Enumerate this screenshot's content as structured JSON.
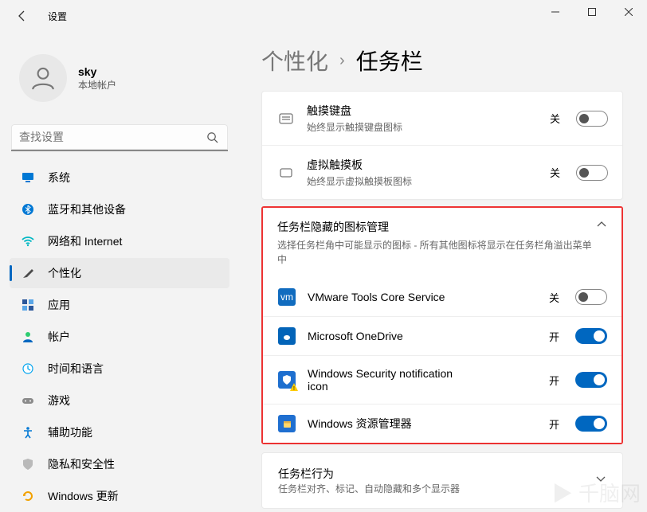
{
  "title_bar": {
    "app_title": "设置"
  },
  "user": {
    "name": "sky",
    "subtitle": "本地帐户"
  },
  "search": {
    "placeholder": "查找设置"
  },
  "nav": [
    {
      "label": "系统",
      "icon": "monitor",
      "color": "#0078d4"
    },
    {
      "label": "蓝牙和其他设备",
      "icon": "bluetooth",
      "color": "#0078d4"
    },
    {
      "label": "网络和 Internet",
      "icon": "wifi",
      "color": "#00b7c3"
    },
    {
      "label": "个性化",
      "icon": "brush",
      "color": "#4b4b4b",
      "selected": true
    },
    {
      "label": "应用",
      "icon": "apps",
      "color": "#2b579a"
    },
    {
      "label": "帐户",
      "icon": "account",
      "color": "#0067c0"
    },
    {
      "label": "时间和语言",
      "icon": "clock",
      "color": "#00a4ef"
    },
    {
      "label": "游戏",
      "icon": "game",
      "color": "#8a8a8a"
    },
    {
      "label": "辅助功能",
      "icon": "accessibility",
      "color": "#0078d4"
    },
    {
      "label": "隐私和安全性",
      "icon": "shield",
      "color": "#888888"
    },
    {
      "label": "Windows 更新",
      "icon": "update",
      "color": "#f2a100"
    }
  ],
  "breadcrumb": {
    "parent": "个性化",
    "current": "任务栏"
  },
  "panel1": {
    "rows": [
      {
        "title": "触摸键盘",
        "sub": "始终显示触摸键盘图标",
        "state_label": "关",
        "on": false
      },
      {
        "title": "虚拟触摸板",
        "sub": "始终显示虚拟触摸板图标",
        "state_label": "关",
        "on": false
      }
    ]
  },
  "section": {
    "title": "任务栏隐藏的图标管理",
    "sub": "选择任务栏角中可能显示的图标 - 所有其他图标将显示在任务栏角溢出菜单中",
    "rows": [
      {
        "title": "VMware Tools Core Service",
        "state_label": "关",
        "on": false,
        "icon_bg": "#116cbf"
      },
      {
        "title": "Microsoft OneDrive",
        "state_label": "开",
        "on": true,
        "icon_bg": "#0364b8"
      },
      {
        "title": "Windows Security notification icon",
        "state_label": "开",
        "on": true,
        "icon_bg": "#1e6fcf"
      },
      {
        "title": "Windows 资源管理器",
        "state_label": "开",
        "on": true,
        "icon_bg": "#1f6fd0"
      }
    ]
  },
  "panel3": {
    "title": "任务栏行为",
    "sub": "任务栏对齐、标记、自动隐藏和多个显示器"
  }
}
